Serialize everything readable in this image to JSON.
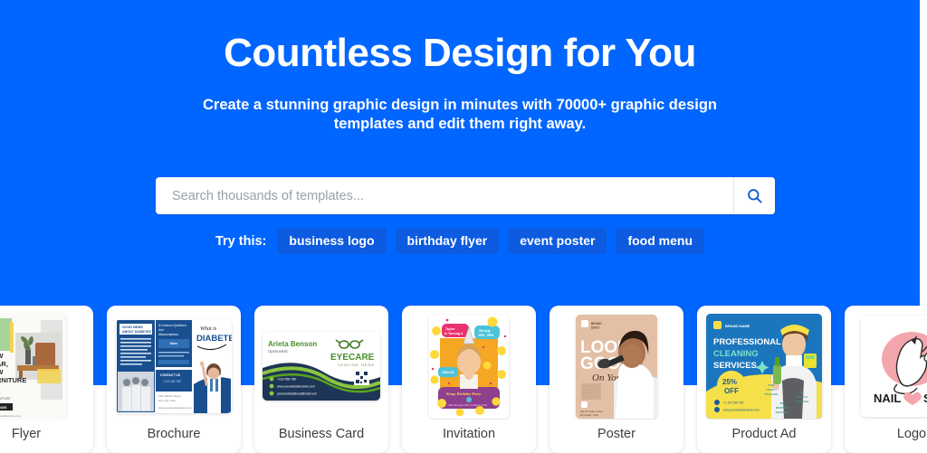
{
  "hero": {
    "title": "Countless Design for You",
    "subtitle": "Create a stunning graphic design in minutes with 70000+ graphic design templates and edit them right away.",
    "background_color": "#0066ff"
  },
  "search": {
    "placeholder": "Search thousands of templates...",
    "value": "",
    "button_icon": "search-icon",
    "button_icon_color": "#0a58d6"
  },
  "suggestions": {
    "label": "Try this:",
    "chip_color": "#0d5be0",
    "items": [
      {
        "label": "business logo"
      },
      {
        "label": "birthday flyer"
      },
      {
        "label": "event poster"
      },
      {
        "label": "food menu"
      }
    ]
  },
  "categories": [
    {
      "label": "Flyer",
      "art": "flyer",
      "headline": "NEW YEAR, NEW FURNITURE",
      "cta": "SHOP NOW"
    },
    {
      "label": "Brochure",
      "art": "brochure",
      "headline": "What is DIABETES ?",
      "kicker": "GOOD NEWS ABOUT DIABETES"
    },
    {
      "label": "Business Card",
      "art": "bizcard",
      "name": "Arieta Benson",
      "role": "Optometrist",
      "brand": "EYECARE",
      "tagline": "TAGLINE HERE"
    },
    {
      "label": "Invitation",
      "art": "invite",
      "headline": "Taylor is Turning 4",
      "date": "9th Aug 2PM - 5PM",
      "rsvp": "Keep Birthday Party"
    },
    {
      "label": "Poster",
      "art": "poster",
      "headline": "LOOK GOOD",
      "script": "On You",
      "address": "Mauch Eden street Boyhawk, USA"
    },
    {
      "label": "Product Ad",
      "art": "prodad",
      "headline": "PROFESSIONAL CLEANING SERVICES",
      "badge": "25% OFF",
      "brand": "BRAND NAME",
      "site": "www.yourwebsitename.com"
    },
    {
      "label": "Logo",
      "art": "logo",
      "wordmark": "NAIL SALON"
    }
  ]
}
